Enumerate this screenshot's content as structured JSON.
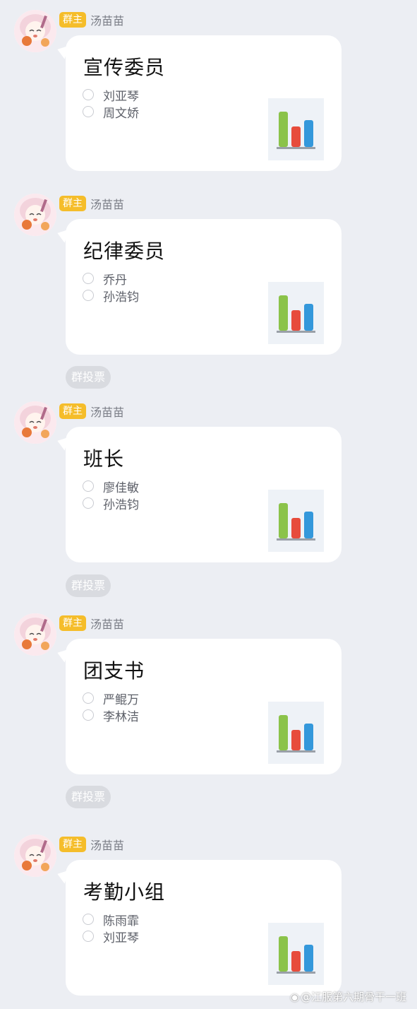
{
  "messages": [
    {
      "sender": "汤苗苗",
      "role_badge": "群主",
      "poll": {
        "title": "宣传委员",
        "options": [
          "刘亚琴",
          "周文娇"
        ]
      }
    },
    {
      "sender": "汤苗苗",
      "role_badge": "群主",
      "poll": {
        "title": "纪律委员",
        "options": [
          "乔丹",
          "孙浩钧"
        ]
      }
    },
    {
      "sender": "汤苗苗",
      "role_badge": "群主",
      "poll": {
        "title": "班长",
        "options": [
          "廖佳敏",
          "孙浩钧"
        ]
      }
    },
    {
      "sender": "汤苗苗",
      "role_badge": "群主",
      "poll": {
        "title": "团支书",
        "options": [
          "严鲲万",
          "李林洁"
        ]
      }
    },
    {
      "sender": "汤苗苗",
      "role_badge": "群主",
      "poll": {
        "title": "考勤小组",
        "options": [
          "陈雨霏",
          "刘亚琴"
        ]
      }
    }
  ],
  "system_labels": [
    "群投票",
    "群投票",
    "群投票"
  ],
  "poll_icon": {
    "name": "bar-chart-icon",
    "bar_colors": [
      "#8bc34a",
      "#e74c3c",
      "#3498db"
    ]
  },
  "watermark": "@江服第六期骨干一班",
  "colors": {
    "background": "#eceef3",
    "bubble": "#ffffff",
    "role_badge": "#f5bd2a"
  }
}
